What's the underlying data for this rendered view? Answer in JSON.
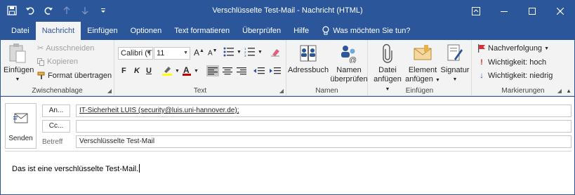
{
  "titlebar": {
    "title": "Verschlüsselte Test-Mail  -  Nachricht (HTML)"
  },
  "tabs": [
    "Datei",
    "Nachricht",
    "Einfügen",
    "Optionen",
    "Text formatieren",
    "Überprüfen",
    "Hilfe"
  ],
  "tell_me": "Was möchten Sie tun?",
  "ribbon": {
    "clipboard": {
      "paste": "Einfügen",
      "cut": "Ausschneiden",
      "copy": "Kopieren",
      "format_painter": "Format übertragen",
      "label": "Zwischenablage"
    },
    "text": {
      "font_name": "Calibri (T",
      "font_size": "11",
      "bold": "F",
      "italic": "K",
      "underline": "U",
      "label": "Text"
    },
    "names": {
      "address_book": "Adressbuch",
      "check_names_1": "Namen",
      "check_names_2": "überprüfen",
      "label": "Namen"
    },
    "insert": {
      "attach_1": "Datei",
      "attach_2": "anfügen",
      "item_1": "Element",
      "item_2": "anfügen",
      "signature": "Signatur",
      "label": "Einfügen"
    },
    "tags": {
      "followup": "Nachverfolgung",
      "high": "Wichtigkeit: hoch",
      "low": "Wichtigkeit: niedrig",
      "label": "Markierungen"
    }
  },
  "compose": {
    "send": "Senden",
    "to_button": "An...",
    "cc_button": "Cc...",
    "subject_label": "Betreff",
    "to_value": "IT-Sicherheit LUIS (security@luis.uni-hannover.de);",
    "cc_value": "",
    "subject_value": "Verschlüsselte Test-Mail",
    "body": "Das ist eine verschlüsselte Test-Mail."
  },
  "colors": {
    "accent": "#2b579a",
    "ribbon_bg": "#f3f3f3",
    "highlight": "#ffff00",
    "font_color": "#c00000"
  }
}
